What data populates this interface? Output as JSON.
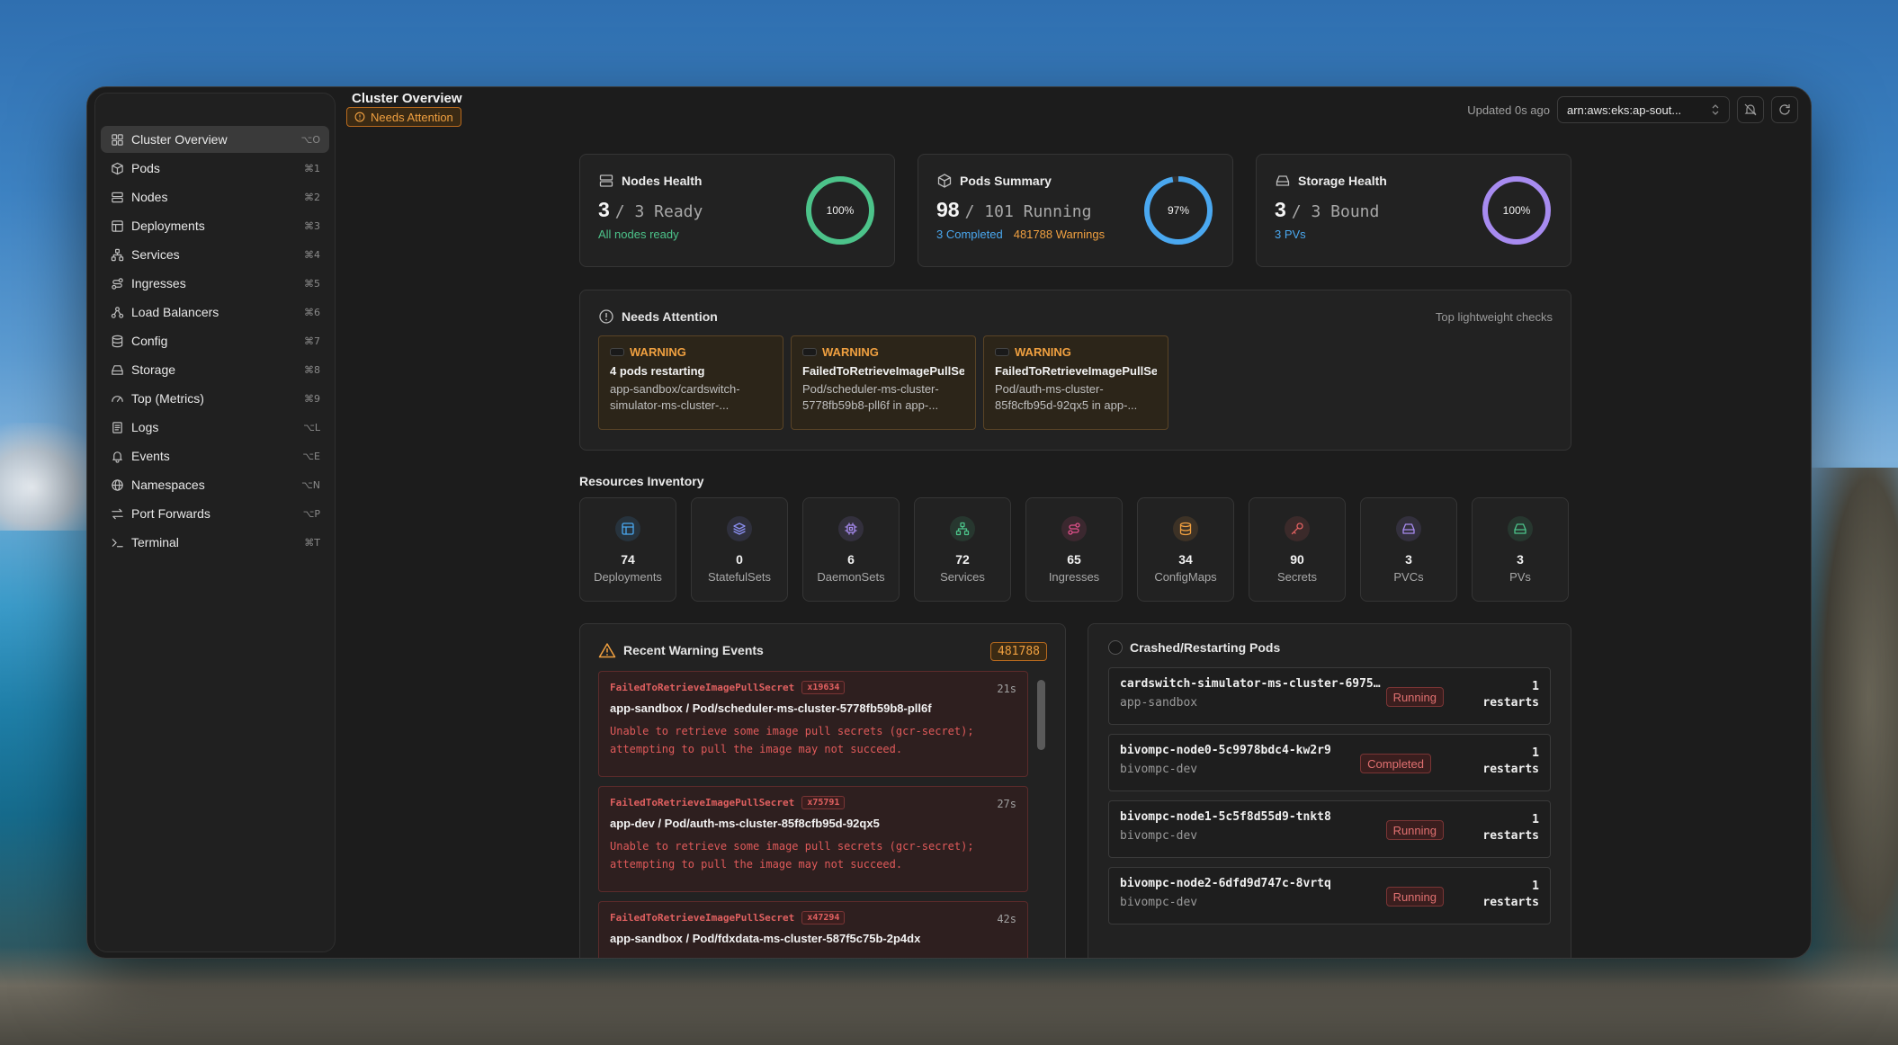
{
  "header": {
    "title": "Cluster Overview",
    "attention_badge": "Needs Attention",
    "updated": "Updated 0s ago",
    "context": "arn:aws:eks:ap-sout..."
  },
  "sidebar": {
    "items": [
      {
        "label": "Cluster Overview",
        "kbd": "⌥O",
        "icon": "grid-icon"
      },
      {
        "label": "Pods",
        "kbd": "⌘1",
        "icon": "cube-icon"
      },
      {
        "label": "Nodes",
        "kbd": "⌘2",
        "icon": "server-icon"
      },
      {
        "label": "Deployments",
        "kbd": "⌘3",
        "icon": "layout-icon"
      },
      {
        "label": "Services",
        "kbd": "⌘4",
        "icon": "network-icon"
      },
      {
        "label": "Ingresses",
        "kbd": "⌘5",
        "icon": "route-icon"
      },
      {
        "label": "Load Balancers",
        "kbd": "⌘6",
        "icon": "balance-icon"
      },
      {
        "label": "Config",
        "kbd": "⌘7",
        "icon": "database-icon"
      },
      {
        "label": "Storage",
        "kbd": "⌘8",
        "icon": "drive-icon"
      },
      {
        "label": "Top (Metrics)",
        "kbd": "⌘9",
        "icon": "gauge-icon"
      },
      {
        "label": "Logs",
        "kbd": "⌥L",
        "icon": "logs-icon"
      },
      {
        "label": "Events",
        "kbd": "⌥E",
        "icon": "bell-icon"
      },
      {
        "label": "Namespaces",
        "kbd": "⌥N",
        "icon": "globe-icon"
      },
      {
        "label": "Port Forwards",
        "kbd": "⌥P",
        "icon": "arrows-icon"
      },
      {
        "label": "Terminal",
        "kbd": "⌘T",
        "icon": "terminal-icon"
      }
    ]
  },
  "health": {
    "nodes": {
      "title": "Nodes Health",
      "count": "3",
      "sub": "/ 3 Ready",
      "foot": "All nodes ready",
      "pct": "100%",
      "fraction": 1.0,
      "color": "#4cc38a"
    },
    "pods": {
      "title": "Pods Summary",
      "count": "98",
      "sub": "/ 101 Running",
      "foot1": "3 Completed",
      "foot2": "481788 Warnings",
      "pct": "97%",
      "fraction": 0.97,
      "color": "#4aa8f0"
    },
    "storage": {
      "title": "Storage Health",
      "count": "3",
      "sub": "/ 3 Bound",
      "foot": "3 PVs",
      "pct": "100%",
      "fraction": 1.0,
      "color": "#a78bf0"
    }
  },
  "attention": {
    "title": "Needs Attention",
    "right": "Top lightweight checks",
    "items": [
      {
        "level": "WARNING",
        "title": "4 pods restarting",
        "desc": "app-sandbox/cardswitch-simulator-ms-cluster-..."
      },
      {
        "level": "WARNING",
        "title": "FailedToRetrieveImagePullSe",
        "desc": "Pod/scheduler-ms-cluster-5778fb59b8-pll6f in app-..."
      },
      {
        "level": "WARNING",
        "title": "FailedToRetrieveImagePullSe",
        "desc": "Pod/auth-ms-cluster-85f8cfb95d-92qx5 in app-..."
      }
    ]
  },
  "inventory": {
    "title": "Resources Inventory",
    "items": [
      {
        "count": "74",
        "label": "Deployments",
        "icon": "layout-icon",
        "color": "#4aa8f0"
      },
      {
        "count": "0",
        "label": "StatefulSets",
        "icon": "layers-icon",
        "color": "#8a8ff0"
      },
      {
        "count": "6",
        "label": "DaemonSets",
        "icon": "chip-icon",
        "color": "#a78bf0"
      },
      {
        "count": "72",
        "label": "Services",
        "icon": "network-icon",
        "color": "#4cc38a"
      },
      {
        "count": "65",
        "label": "Ingresses",
        "icon": "route-icon",
        "color": "#e0508a"
      },
      {
        "count": "34",
        "label": "ConfigMaps",
        "icon": "database-icon",
        "color": "#f0a040"
      },
      {
        "count": "90",
        "label": "Secrets",
        "icon": "key-icon",
        "color": "#e06060"
      },
      {
        "count": "3",
        "label": "PVCs",
        "icon": "drive-icon",
        "color": "#a78bf0"
      },
      {
        "count": "3",
        "label": "PVs",
        "icon": "drive-icon",
        "color": "#4cc38a"
      }
    ]
  },
  "events": {
    "title": "Recent Warning Events",
    "count": "481788",
    "items": [
      {
        "reason": "FailedToRetrieveImagePullSecret",
        "x": "x19634",
        "age": "21s",
        "target": "app-sandbox / Pod/scheduler-ms-cluster-5778fb59b8-pll6f",
        "msg": "Unable to retrieve some image pull secrets (gcr-secret); attempting to pull the image may not succeed."
      },
      {
        "reason": "FailedToRetrieveImagePullSecret",
        "x": "x75791",
        "age": "27s",
        "target": "app-dev / Pod/auth-ms-cluster-85f8cfb95d-92qx5",
        "msg": "Unable to retrieve some image pull secrets (gcr-secret); attempting to pull the image may not succeed."
      },
      {
        "reason": "FailedToRetrieveImagePullSecret",
        "x": "x47294",
        "age": "42s",
        "target": "app-sandbox / Pod/fdxdata-ms-cluster-587f5c75b-2p4dx",
        "msg": ""
      }
    ]
  },
  "crashed": {
    "title": "Crashed/Restarting Pods",
    "items": [
      {
        "name": "cardswitch-simulator-ms-cluster-6975…",
        "ns": "app-sandbox",
        "status": "Running",
        "restarts": "1",
        "restarts_label": "restarts"
      },
      {
        "name": "bivompc-node0-5c9978bdc4-kw2r9",
        "ns": "bivompc-dev",
        "status": "Completed",
        "restarts": "1",
        "restarts_label": "restarts"
      },
      {
        "name": "bivompc-node1-5c5f8d55d9-tnkt8",
        "ns": "bivompc-dev",
        "status": "Running",
        "restarts": "1",
        "restarts_label": "restarts"
      },
      {
        "name": "bivompc-node2-6dfd9d747c-8vrtq",
        "ns": "bivompc-dev",
        "status": "Running",
        "restarts": "1",
        "restarts_label": "restarts"
      }
    ]
  }
}
